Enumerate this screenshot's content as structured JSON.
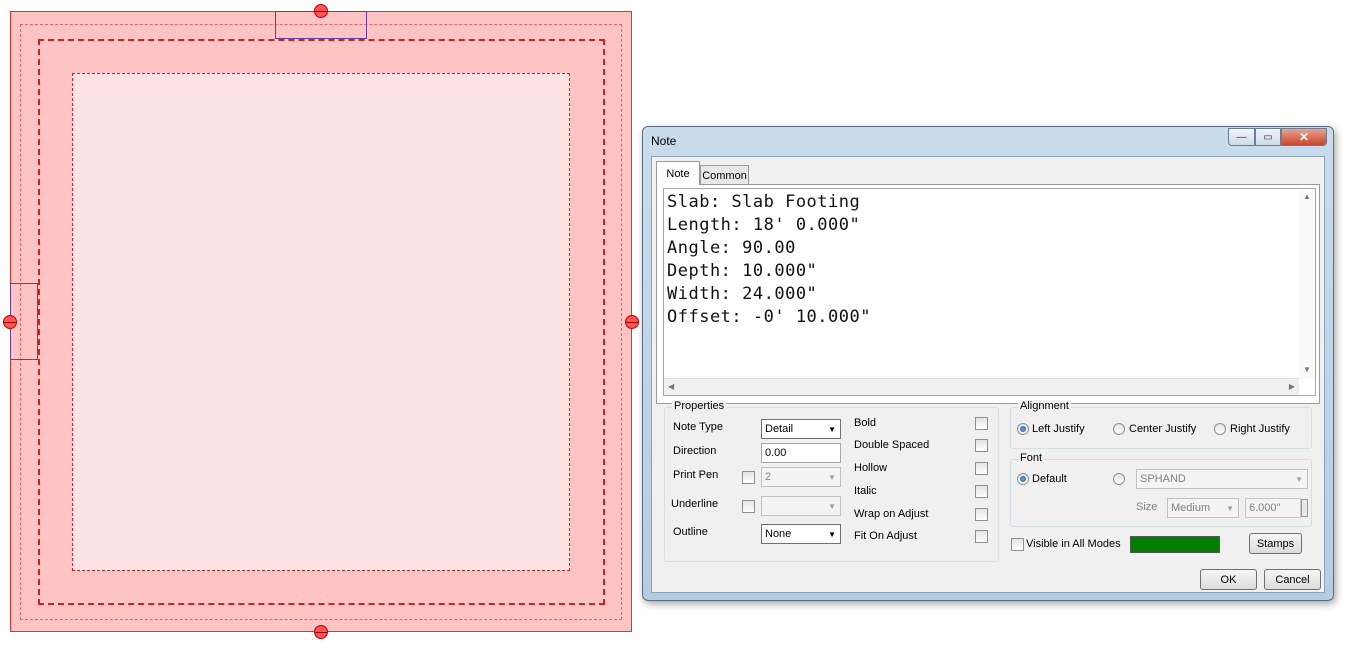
{
  "dialog": {
    "title": "Note",
    "window_buttons": {
      "minimize": "—",
      "maximize": "▭",
      "close": "✕"
    },
    "tabs": [
      {
        "label": "Note",
        "active": true
      },
      {
        "label": "Common",
        "active": false
      }
    ],
    "note_text": [
      "Slab: Slab Footing",
      "Length: 18' 0.000\"",
      "Angle: 90.00",
      "Depth: 10.000\"",
      "Width: 24.000\"",
      "Offset: -0' 10.000\""
    ],
    "properties": {
      "group_label": "Properties",
      "note_type": {
        "label": "Note Type",
        "value": "Detail"
      },
      "direction": {
        "label": "Direction",
        "value": "0.00"
      },
      "print_pen": {
        "label": "Print Pen",
        "checked": false,
        "value": "2"
      },
      "underline": {
        "label": "Underline",
        "checked": false,
        "value": ""
      },
      "outline": {
        "label": "Outline",
        "value": "None"
      },
      "checks": [
        {
          "label": "Bold",
          "checked": false
        },
        {
          "label": "Double Spaced",
          "checked": false
        },
        {
          "label": "Hollow",
          "checked": false
        },
        {
          "label": "Italic",
          "checked": false
        },
        {
          "label": "Wrap on Adjust",
          "checked": false
        },
        {
          "label": "Fit On Adjust",
          "checked": false
        }
      ]
    },
    "alignment": {
      "group_label": "Alignment",
      "options": [
        "Left Justify",
        "Center Justify",
        "Right Justify"
      ],
      "selected": "Left Justify"
    },
    "font": {
      "group_label": "Font",
      "default_label": "Default",
      "default_selected": true,
      "font_name": "SPHAND",
      "size_label": "Size",
      "size_value": "Medium",
      "size_measure": "6.000\""
    },
    "visible_in_all_modes": {
      "label": "Visible in All Modes",
      "checked": false
    },
    "color_swatch": "#007f00",
    "buttons": {
      "stamps": "Stamps",
      "ok": "OK",
      "cancel": "Cancel"
    }
  },
  "colors": {
    "slab_fill": "#fec3c3",
    "slab_inner_fill": "#fde3e3",
    "slab_line": "#cc2222",
    "handle": "#ff5555"
  }
}
